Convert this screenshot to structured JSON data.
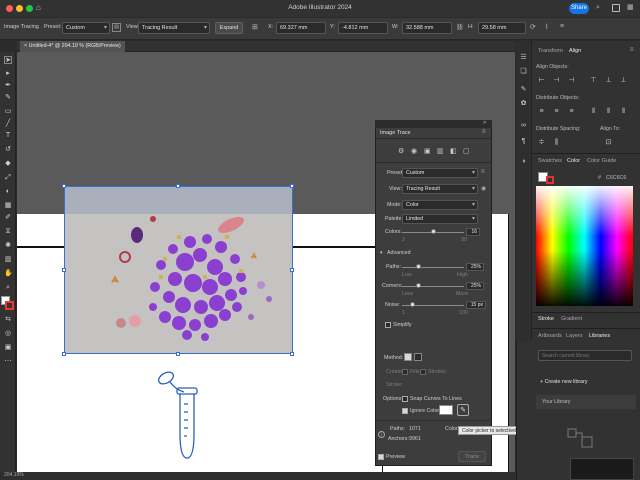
{
  "window": {
    "title": "Adobe Illustrator 2024",
    "share_label": "Share"
  },
  "control_bar": {
    "mode_label": "Image Tracing",
    "preset_label": "Preset:",
    "preset_value": "Custom",
    "view_label": "View:",
    "view_value": "Tracing Result",
    "expand_label": "Expand",
    "x_value": "69.327 mm",
    "y_value": "-4.812 mm",
    "w_value": "32.588 mm",
    "h_value": "29.58 mm"
  },
  "document": {
    "tab_label": "Untitled-4* @ 204.19 % (RGB/Preview)",
    "close_symbol": "×"
  },
  "image_trace": {
    "title": "Image Trace",
    "preset_label": "Preset:",
    "preset_value": "Custom",
    "view_label": "View:",
    "view_value": "Tracing Result",
    "mode_label": "Mode:",
    "mode_value": "Color",
    "palette_label": "Palette:",
    "palette_value": "Limited",
    "colors_label": "Colors:",
    "colors_value": "16",
    "colors_min": "2",
    "colors_max": "30",
    "advanced_label": "Advanced",
    "paths_label": "Paths:",
    "paths_value": "25%",
    "paths_low": "Low",
    "paths_high": "High",
    "corners_label": "Corners:",
    "corners_value": "25%",
    "corners_less": "Less",
    "corners_more": "More",
    "noise_label": "Noise:",
    "noise_value": "15 px",
    "noise_min": "1",
    "noise_max": "100",
    "simplify_label": "Simplify",
    "method_label": "Method:",
    "create_label": "Create:",
    "fills_label": "Fills",
    "strokes_label": "Strokes",
    "stroke_label": "Stroke:",
    "options_label": "Options:",
    "snap_label": "Snap Curves To Lines",
    "ignore_label": "Ignore Color",
    "paths_count_label": "Paths:",
    "paths_count": "1071",
    "colors_count_label": "Colors:",
    "anchors_label": "Anchors:",
    "anchors_count": "9961",
    "preview_label": "Preview",
    "trace_label": "Trace",
    "tooltip": "Color picker to selectively ignore color"
  },
  "right_panel": {
    "tabs_top": [
      "Transform",
      "Align"
    ],
    "align_objects": "Align Objects:",
    "distribute_objects": "Distribute Objects:",
    "distribute_spacing": "Distribute Spacing:",
    "align_to": "Align To:",
    "tabs_color": [
      "Swatches",
      "Color",
      "Color Guide"
    ],
    "hex_symbol": "#",
    "hex_value": "C6C6C6",
    "tabs_stroke": [
      "Stroke",
      "Gradient"
    ],
    "tabs_lib": [
      "Artboards",
      "Layers",
      "Libraries"
    ],
    "search_placeholder": "Search current library",
    "create_library": "+ Create new library",
    "your_library": "Your Library"
  },
  "status_bar": {
    "zoom": "204.19%"
  },
  "colors": {
    "accent": "#1473e6",
    "selection": "#3b6fd6",
    "panel": "#3d3d3d",
    "trace_purple": "#8a3fd1"
  }
}
